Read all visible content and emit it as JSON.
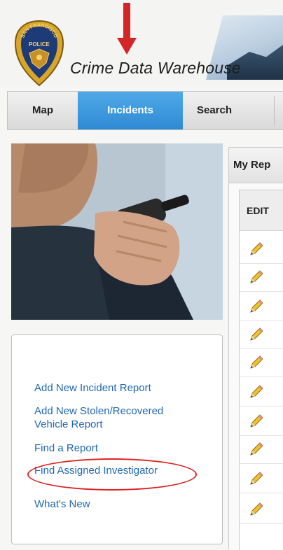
{
  "header": {
    "app_title": "Crime Data Warehouse",
    "badge": {
      "top_text": "SAN FRANCISCO",
      "middle_text": "POLICE"
    },
    "arrow_color": "#d32727"
  },
  "nav": {
    "tabs": [
      {
        "label": "Map",
        "active": false
      },
      {
        "label": "Incidents",
        "active": true
      },
      {
        "label": "Search",
        "active": false
      }
    ],
    "active_color": "#2f8ad3"
  },
  "links": [
    {
      "label": "Add New Incident Report"
    },
    {
      "label": "Add New Stolen/Recovered Vehicle Report"
    },
    {
      "label": "Find a Report"
    },
    {
      "label": "Find Assigned Investigator",
      "highlighted": true
    },
    {
      "label": "What's New"
    }
  ],
  "reports": {
    "title": "My Rep",
    "column_header": "EDIT",
    "row_icon": "pencil-icon"
  },
  "colors": {
    "link": "#1f67b5",
    "highlight_circle": "#dd2222"
  }
}
